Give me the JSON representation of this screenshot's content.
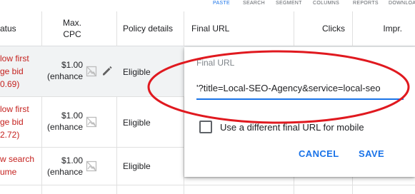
{
  "toolbar": {
    "items": [
      "PASTE",
      "SEARCH",
      "SEGMENT",
      "COLUMNS",
      "REPORTS",
      "DOWNLOAD"
    ]
  },
  "table": {
    "headers": {
      "status": "atus",
      "max_cpc": "Max.\nCPC",
      "policy": "Policy details",
      "final_url": "Final URL",
      "clicks": "Clicks",
      "impr": "Impr."
    },
    "rows": [
      {
        "status_lines": [
          "low first",
          "ge bid",
          "0.69)"
        ],
        "bid_line1": "$1.00",
        "bid_line2": "(enhance",
        "policy": "Eligible"
      },
      {
        "status_lines": [
          "low first",
          "ge bid",
          "2.72)"
        ],
        "bid_line1": "$1.00",
        "bid_line2": "(enhance",
        "policy": "Eligible"
      },
      {
        "status_lines": [
          "w search",
          "ume"
        ],
        "bid_line1": "$1.00",
        "bid_line2": "(enhance",
        "policy": "Eligible"
      }
    ]
  },
  "dialog": {
    "field_label": "Final URL",
    "field_value": "'?title=Local-SEO-Agency&service=local-seo",
    "checkbox_label": "Use a different final URL for mobile",
    "checkbox_checked": false,
    "cancel_label": "CANCEL",
    "save_label": "SAVE"
  },
  "colors": {
    "accent": "#1a73e8",
    "status_red": "#c5221f",
    "annotation_red": "#e0191f"
  },
  "icons": {
    "image": "image-placeholder-icon",
    "edit": "pencil-icon",
    "checkbox": "checkbox-icon"
  }
}
